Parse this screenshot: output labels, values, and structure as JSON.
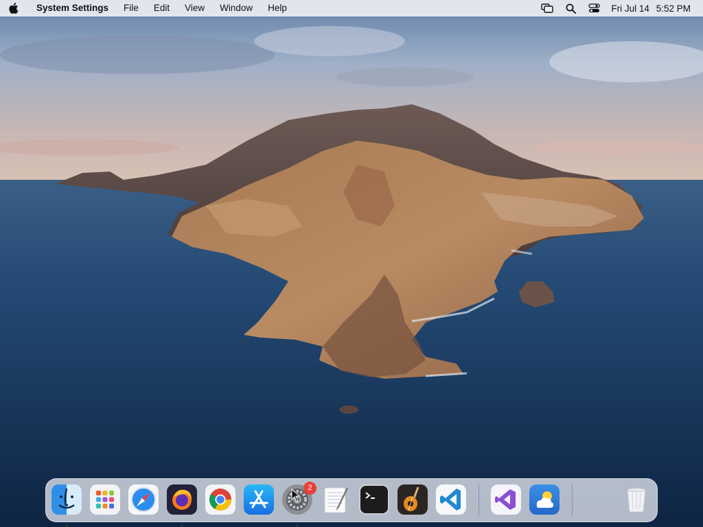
{
  "menubar": {
    "app_name": "System Settings",
    "menus": [
      "File",
      "Edit",
      "View",
      "Window",
      "Help"
    ],
    "status_icons": [
      "screen-mirroring-icon",
      "spotlight-search-icon",
      "control-center-icon"
    ],
    "clock": {
      "date": "Fri Jul 14",
      "time": "5:52 PM"
    }
  },
  "wallpaper": {
    "description_icon": "island-landscape"
  },
  "dock": {
    "apps": [
      {
        "name": "Finder",
        "icon": "finder-icon",
        "running": true
      },
      {
        "name": "Launchpad",
        "icon": "launchpad-icon",
        "running": false
      },
      {
        "name": "Safari",
        "icon": "safari-icon",
        "running": false
      },
      {
        "name": "Firefox",
        "icon": "firefox-icon",
        "running": true
      },
      {
        "name": "Google Chrome",
        "icon": "chrome-icon",
        "running": false
      },
      {
        "name": "App Store",
        "icon": "app-store-icon",
        "running": false
      },
      {
        "name": "System Settings",
        "icon": "system-settings-icon",
        "running": true,
        "badge": "2"
      },
      {
        "name": "TextEdit",
        "icon": "textedit-icon",
        "running": false
      },
      {
        "name": "Terminal",
        "icon": "terminal-icon",
        "running": false
      },
      {
        "name": "GarageBand",
        "icon": "garageband-icon",
        "running": false
      },
      {
        "name": "Visual Studio Code",
        "icon": "vscode-icon",
        "running": false
      },
      {
        "name": "Visual Studio",
        "icon": "visual-studio-icon",
        "running": false
      },
      {
        "name": "Weather",
        "icon": "weather-icon",
        "running": false
      },
      {
        "name": "Trash",
        "icon": "trash-icon",
        "running": false
      }
    ]
  },
  "colors": {
    "menubar_bg": "#eceef2",
    "badge": "#e8403a",
    "sea": "#1c3f66",
    "sky": "#8fa6c2"
  }
}
